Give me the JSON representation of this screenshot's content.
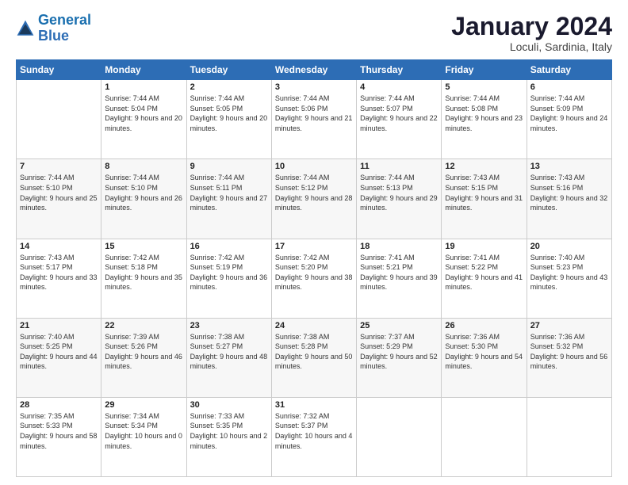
{
  "logo": {
    "line1": "General",
    "line2": "Blue"
  },
  "title": "January 2024",
  "subtitle": "Loculi, Sardinia, Italy",
  "headers": [
    "Sunday",
    "Monday",
    "Tuesday",
    "Wednesday",
    "Thursday",
    "Friday",
    "Saturday"
  ],
  "weeks": [
    [
      {
        "day": "",
        "sunrise": "",
        "sunset": "",
        "daylight": ""
      },
      {
        "day": "1",
        "sunrise": "Sunrise: 7:44 AM",
        "sunset": "Sunset: 5:04 PM",
        "daylight": "Daylight: 9 hours and 20 minutes."
      },
      {
        "day": "2",
        "sunrise": "Sunrise: 7:44 AM",
        "sunset": "Sunset: 5:05 PM",
        "daylight": "Daylight: 9 hours and 20 minutes."
      },
      {
        "day": "3",
        "sunrise": "Sunrise: 7:44 AM",
        "sunset": "Sunset: 5:06 PM",
        "daylight": "Daylight: 9 hours and 21 minutes."
      },
      {
        "day": "4",
        "sunrise": "Sunrise: 7:44 AM",
        "sunset": "Sunset: 5:07 PM",
        "daylight": "Daylight: 9 hours and 22 minutes."
      },
      {
        "day": "5",
        "sunrise": "Sunrise: 7:44 AM",
        "sunset": "Sunset: 5:08 PM",
        "daylight": "Daylight: 9 hours and 23 minutes."
      },
      {
        "day": "6",
        "sunrise": "Sunrise: 7:44 AM",
        "sunset": "Sunset: 5:09 PM",
        "daylight": "Daylight: 9 hours and 24 minutes."
      }
    ],
    [
      {
        "day": "7",
        "sunrise": "Sunrise: 7:44 AM",
        "sunset": "Sunset: 5:10 PM",
        "daylight": "Daylight: 9 hours and 25 minutes."
      },
      {
        "day": "8",
        "sunrise": "Sunrise: 7:44 AM",
        "sunset": "Sunset: 5:10 PM",
        "daylight": "Daylight: 9 hours and 26 minutes."
      },
      {
        "day": "9",
        "sunrise": "Sunrise: 7:44 AM",
        "sunset": "Sunset: 5:11 PM",
        "daylight": "Daylight: 9 hours and 27 minutes."
      },
      {
        "day": "10",
        "sunrise": "Sunrise: 7:44 AM",
        "sunset": "Sunset: 5:12 PM",
        "daylight": "Daylight: 9 hours and 28 minutes."
      },
      {
        "day": "11",
        "sunrise": "Sunrise: 7:44 AM",
        "sunset": "Sunset: 5:13 PM",
        "daylight": "Daylight: 9 hours and 29 minutes."
      },
      {
        "day": "12",
        "sunrise": "Sunrise: 7:43 AM",
        "sunset": "Sunset: 5:15 PM",
        "daylight": "Daylight: 9 hours and 31 minutes."
      },
      {
        "day": "13",
        "sunrise": "Sunrise: 7:43 AM",
        "sunset": "Sunset: 5:16 PM",
        "daylight": "Daylight: 9 hours and 32 minutes."
      }
    ],
    [
      {
        "day": "14",
        "sunrise": "Sunrise: 7:43 AM",
        "sunset": "Sunset: 5:17 PM",
        "daylight": "Daylight: 9 hours and 33 minutes."
      },
      {
        "day": "15",
        "sunrise": "Sunrise: 7:42 AM",
        "sunset": "Sunset: 5:18 PM",
        "daylight": "Daylight: 9 hours and 35 minutes."
      },
      {
        "day": "16",
        "sunrise": "Sunrise: 7:42 AM",
        "sunset": "Sunset: 5:19 PM",
        "daylight": "Daylight: 9 hours and 36 minutes."
      },
      {
        "day": "17",
        "sunrise": "Sunrise: 7:42 AM",
        "sunset": "Sunset: 5:20 PM",
        "daylight": "Daylight: 9 hours and 38 minutes."
      },
      {
        "day": "18",
        "sunrise": "Sunrise: 7:41 AM",
        "sunset": "Sunset: 5:21 PM",
        "daylight": "Daylight: 9 hours and 39 minutes."
      },
      {
        "day": "19",
        "sunrise": "Sunrise: 7:41 AM",
        "sunset": "Sunset: 5:22 PM",
        "daylight": "Daylight: 9 hours and 41 minutes."
      },
      {
        "day": "20",
        "sunrise": "Sunrise: 7:40 AM",
        "sunset": "Sunset: 5:23 PM",
        "daylight": "Daylight: 9 hours and 43 minutes."
      }
    ],
    [
      {
        "day": "21",
        "sunrise": "Sunrise: 7:40 AM",
        "sunset": "Sunset: 5:25 PM",
        "daylight": "Daylight: 9 hours and 44 minutes."
      },
      {
        "day": "22",
        "sunrise": "Sunrise: 7:39 AM",
        "sunset": "Sunset: 5:26 PM",
        "daylight": "Daylight: 9 hours and 46 minutes."
      },
      {
        "day": "23",
        "sunrise": "Sunrise: 7:38 AM",
        "sunset": "Sunset: 5:27 PM",
        "daylight": "Daylight: 9 hours and 48 minutes."
      },
      {
        "day": "24",
        "sunrise": "Sunrise: 7:38 AM",
        "sunset": "Sunset: 5:28 PM",
        "daylight": "Daylight: 9 hours and 50 minutes."
      },
      {
        "day": "25",
        "sunrise": "Sunrise: 7:37 AM",
        "sunset": "Sunset: 5:29 PM",
        "daylight": "Daylight: 9 hours and 52 minutes."
      },
      {
        "day": "26",
        "sunrise": "Sunrise: 7:36 AM",
        "sunset": "Sunset: 5:30 PM",
        "daylight": "Daylight: 9 hours and 54 minutes."
      },
      {
        "day": "27",
        "sunrise": "Sunrise: 7:36 AM",
        "sunset": "Sunset: 5:32 PM",
        "daylight": "Daylight: 9 hours and 56 minutes."
      }
    ],
    [
      {
        "day": "28",
        "sunrise": "Sunrise: 7:35 AM",
        "sunset": "Sunset: 5:33 PM",
        "daylight": "Daylight: 9 hours and 58 minutes."
      },
      {
        "day": "29",
        "sunrise": "Sunrise: 7:34 AM",
        "sunset": "Sunset: 5:34 PM",
        "daylight": "Daylight: 10 hours and 0 minutes."
      },
      {
        "day": "30",
        "sunrise": "Sunrise: 7:33 AM",
        "sunset": "Sunset: 5:35 PM",
        "daylight": "Daylight: 10 hours and 2 minutes."
      },
      {
        "day": "31",
        "sunrise": "Sunrise: 7:32 AM",
        "sunset": "Sunset: 5:37 PM",
        "daylight": "Daylight: 10 hours and 4 minutes."
      },
      {
        "day": "",
        "sunrise": "",
        "sunset": "",
        "daylight": ""
      },
      {
        "day": "",
        "sunrise": "",
        "sunset": "",
        "daylight": ""
      },
      {
        "day": "",
        "sunrise": "",
        "sunset": "",
        "daylight": ""
      }
    ]
  ]
}
